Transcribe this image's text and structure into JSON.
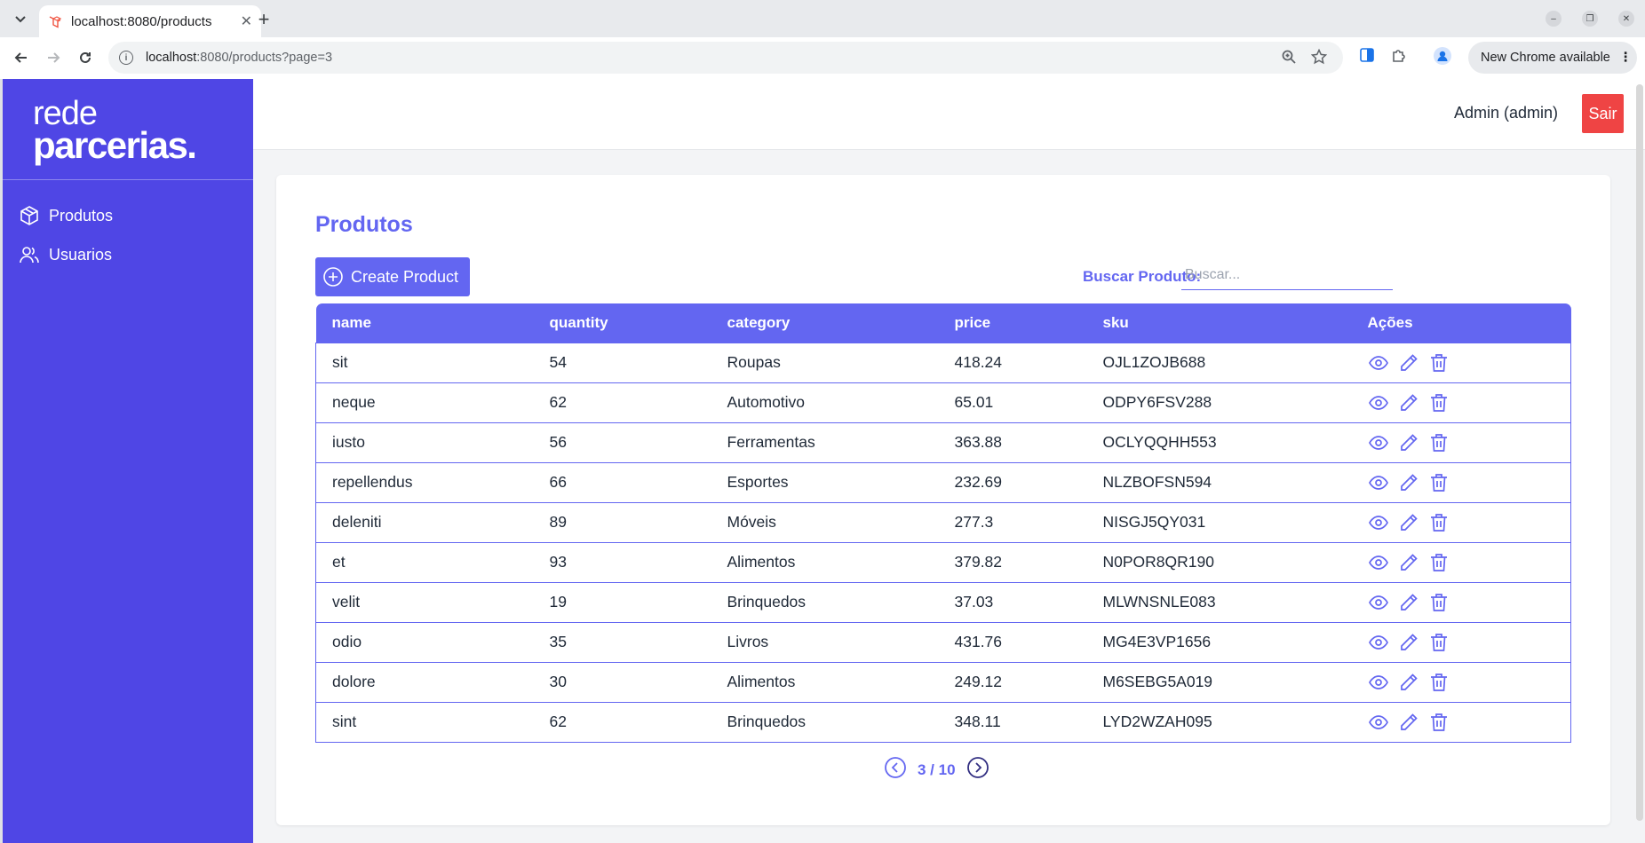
{
  "browser": {
    "tab_title": "localhost:8080/products",
    "url_host": "localhost",
    "url_path": ":8080/products?page=3",
    "new_chrome_label": "New Chrome available"
  },
  "sidebar": {
    "logo_line1": "rede",
    "logo_line2": "parcerias.",
    "items": [
      {
        "label": "Produtos",
        "icon": "cube-icon"
      },
      {
        "label": "Usuarios",
        "icon": "users-icon"
      }
    ]
  },
  "header": {
    "user_label": "Admin (admin)",
    "logout_label": "Sair"
  },
  "products": {
    "title": "Produtos",
    "create_label": "Create Product",
    "search_label": "Buscar Produto:",
    "search_placeholder": "Buscar...",
    "search_value": "",
    "columns": [
      "name",
      "quantity",
      "category",
      "price",
      "sku",
      "Ações"
    ],
    "rows": [
      {
        "name": "sit",
        "quantity": "54",
        "category": "Roupas",
        "price": "418.24",
        "sku": "OJL1ZOJB688"
      },
      {
        "name": "neque",
        "quantity": "62",
        "category": "Automotivo",
        "price": "65.01",
        "sku": "ODPY6FSV288"
      },
      {
        "name": "iusto",
        "quantity": "56",
        "category": "Ferramentas",
        "price": "363.88",
        "sku": "OCLYQQHH553"
      },
      {
        "name": "repellendus",
        "quantity": "66",
        "category": "Esportes",
        "price": "232.69",
        "sku": "NLZBOFSN594"
      },
      {
        "name": "deleniti",
        "quantity": "89",
        "category": "Móveis",
        "price": "277.3",
        "sku": "NISGJ5QY031"
      },
      {
        "name": "et",
        "quantity": "93",
        "category": "Alimentos",
        "price": "379.82",
        "sku": "N0POR8QR190"
      },
      {
        "name": "velit",
        "quantity": "19",
        "category": "Brinquedos",
        "price": "37.03",
        "sku": "MLWNSNLE083"
      },
      {
        "name": "odio",
        "quantity": "35",
        "category": "Livros",
        "price": "431.76",
        "sku": "MG4E3VP1656"
      },
      {
        "name": "dolore",
        "quantity": "30",
        "category": "Alimentos",
        "price": "249.12",
        "sku": "M6SEBG5A019"
      },
      {
        "name": "sint",
        "quantity": "62",
        "category": "Brinquedos",
        "price": "348.11",
        "sku": "LYD2WZAH095"
      }
    ],
    "pagination": "3 / 10"
  },
  "colors": {
    "sidebar": "#4f46e5",
    "accent": "#6366f1",
    "danger": "#ef4444"
  }
}
